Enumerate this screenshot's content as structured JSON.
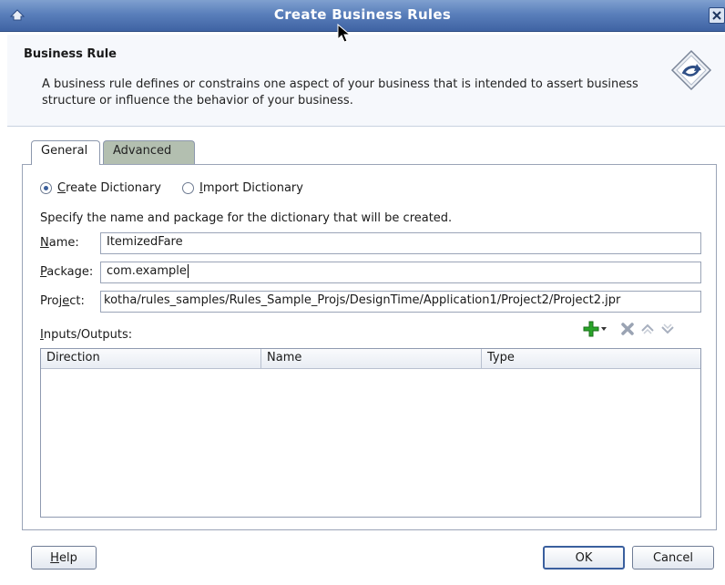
{
  "window": {
    "title": "Create Business Rules",
    "close_icon": "close-icon"
  },
  "header": {
    "title": "Business Rule",
    "description": "A business rule defines or constrains one aspect of your business that is intended to assert business structure or influence the behavior of your business.",
    "icon": "business-rule-icon"
  },
  "tabs": [
    {
      "label": "General",
      "selected": true
    },
    {
      "label": "Advanced",
      "selected": false
    }
  ],
  "general": {
    "radios": [
      {
        "mnemonic": "C",
        "rest": "reate Dictionary",
        "selected": true
      },
      {
        "mnemonic": "I",
        "rest": "mport Dictionary",
        "selected": false
      }
    ],
    "instructions": "Specify the name and package for the dictionary that will be created.",
    "name": {
      "mnemonic": "N",
      "rest": "ame:",
      "value": "ItemizedFare"
    },
    "package": {
      "mnemonic": "P",
      "rest": "ackage:",
      "value": "com.example"
    },
    "project": {
      "label_pre": "Proj",
      "mnemonic": "e",
      "label_post": "ct:",
      "value": "kotha/rules_samples/Rules_Sample_Projs/DesignTime/Application1/Project2/Project2.jpr"
    },
    "io": {
      "mnemonic": "I",
      "rest": "nputs/Outputs:",
      "columns": [
        "Direction",
        "Name",
        "Type"
      ],
      "toolbar_icons": [
        "add-icon",
        "dropdown-arrow-icon",
        "delete-icon",
        "move-up-icon",
        "move-down-icon"
      ]
    }
  },
  "buttons": {
    "help": {
      "mnemonic": "H",
      "rest": "elp"
    },
    "ok": "OK",
    "cancel": "Cancel"
  },
  "colors": {
    "titlebar": "#4a6fae",
    "selected_tab": "#ffffff",
    "unselected_tab": "#b3bfb0",
    "add_icon": "#2aa52a"
  }
}
